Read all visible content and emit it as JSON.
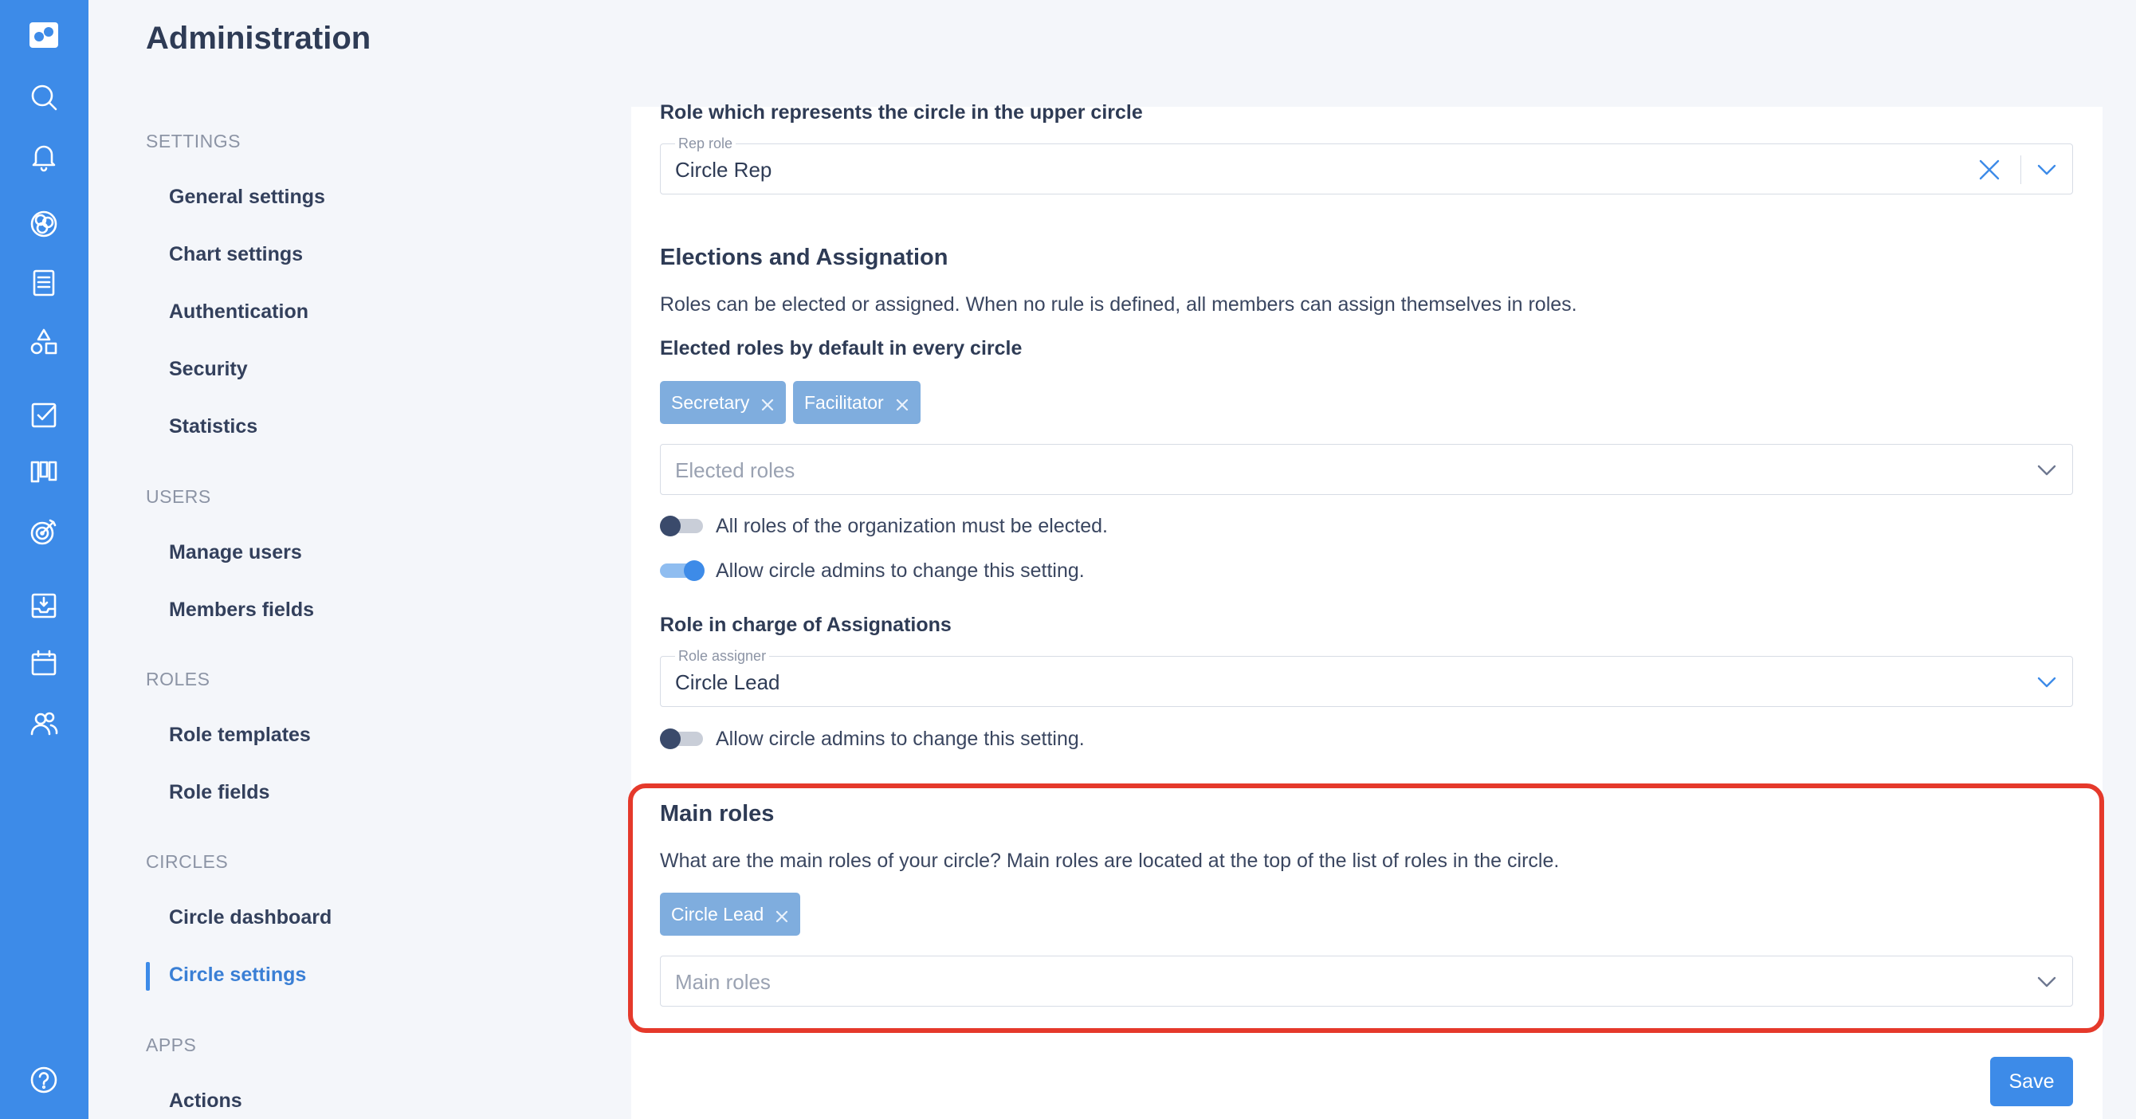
{
  "page": {
    "title": "Administration"
  },
  "rail": {
    "icons": [
      "app-logo-icon",
      "search-icon",
      "bell-icon",
      "circles-icon",
      "document-icon",
      "shapes-icon",
      "checkbox-icon",
      "board-icon",
      "target-icon",
      "inbox-icon",
      "calendar-icon",
      "people-icon",
      "help-icon"
    ]
  },
  "nav": {
    "sections": [
      {
        "label": "SETTINGS",
        "items": [
          "General settings",
          "Chart settings",
          "Authentication",
          "Security",
          "Statistics"
        ]
      },
      {
        "label": "USERS",
        "items": [
          "Manage users",
          "Members fields"
        ]
      },
      {
        "label": "ROLES",
        "items": [
          "Role templates",
          "Role fields"
        ]
      },
      {
        "label": "CIRCLES",
        "items": [
          "Circle dashboard",
          "Circle settings"
        ]
      },
      {
        "label": "APPS",
        "items": [
          "Actions"
        ]
      }
    ],
    "active": "Circle settings"
  },
  "content": {
    "rep_heading": "Role which represents the circle in the upper circle",
    "rep_field": {
      "label": "Rep role",
      "value": "Circle Rep"
    },
    "elections": {
      "title": "Elections and Assignation",
      "description": "Roles can be elected or assigned. When no rule is defined, all members can assign themselves in roles.",
      "elected_label": "Elected roles by default in every circle",
      "chips": [
        "Secretary",
        "Facilitator"
      ],
      "placeholder": "Elected roles",
      "toggle_all": {
        "label": "All roles of the organization must be elected.",
        "on": false
      },
      "toggle_admins": {
        "label": "Allow circle admins to change this setting.",
        "on": true
      }
    },
    "assignation": {
      "title": "Role in charge of Assignations",
      "field_label": "Role assigner",
      "value": "Circle Lead",
      "toggle_admins": {
        "label": "Allow circle admins to change this setting.",
        "on": false
      }
    },
    "main_roles": {
      "title": "Main roles",
      "description": "What are the main roles of your circle? Main roles are located at the top of the list of roles in the circle.",
      "chips": [
        "Circle Lead"
      ],
      "placeholder": "Main roles"
    },
    "save_label": "Save"
  },
  "colors": {
    "accent": "#3d8be8",
    "highlight": "#e5392b",
    "chip": "#7fadde"
  }
}
